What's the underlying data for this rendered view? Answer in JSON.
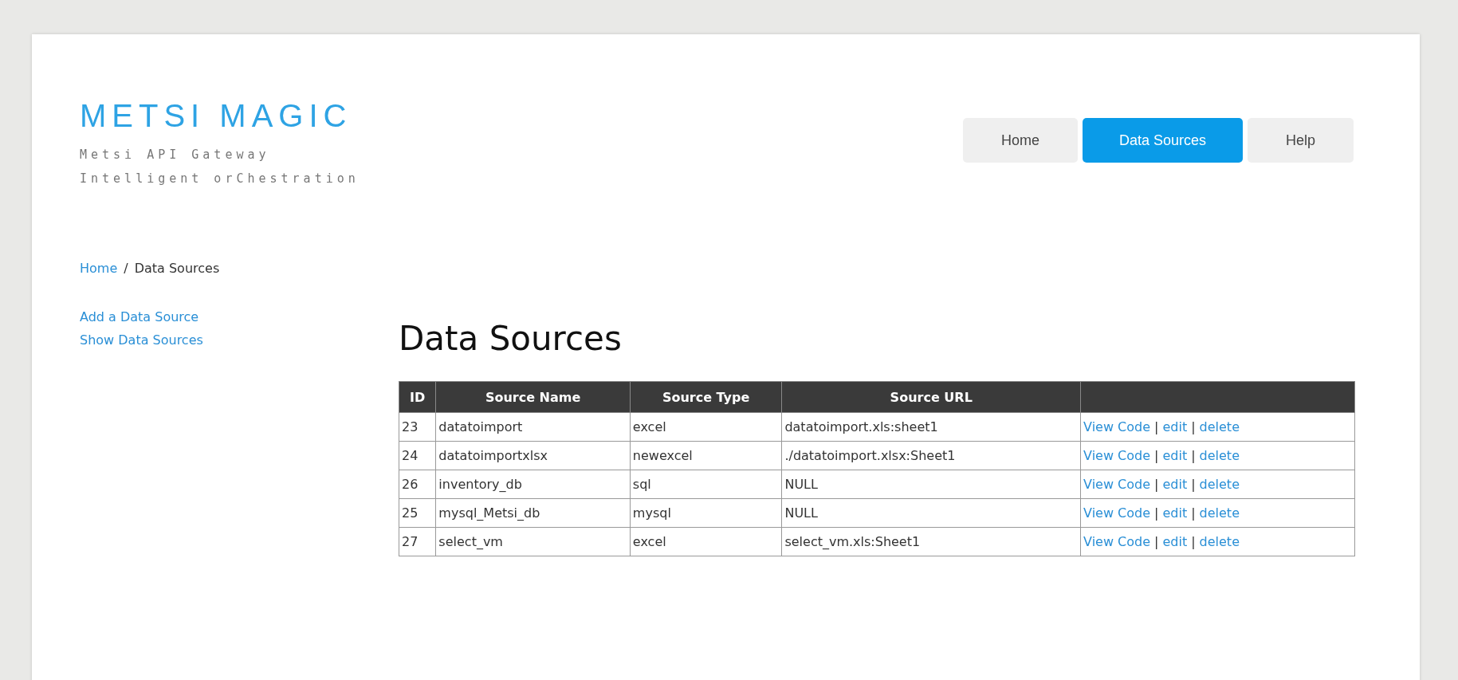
{
  "brand": {
    "title": "METSI MAGIC",
    "taglines": [
      "Metsi API Gateway",
      "Intelligent orChestration"
    ]
  },
  "nav": [
    {
      "label": "Home",
      "selected": false
    },
    {
      "label": "Data Sources",
      "selected": true
    },
    {
      "label": "Help",
      "selected": false
    }
  ],
  "breadcrumb": {
    "link": "Home",
    "separator": "/",
    "current": "Data Sources"
  },
  "sidebar": {
    "items": [
      "Add a Data Source",
      "Show Data Sources"
    ]
  },
  "heading": "Data Sources",
  "table": {
    "columns": [
      "ID",
      "Source Name",
      "Source Type",
      "Source URL"
    ],
    "action_separator": "|",
    "rows": [
      {
        "cells": [
          "23",
          "datatoimport",
          "excel",
          "datatoimport.xls:sheet1"
        ],
        "actions": [
          "View Code",
          "edit",
          "delete"
        ]
      },
      {
        "cells": [
          "24",
          "datatoimportxlsx",
          "newexcel",
          "./datatoimport.xlsx:Sheet1"
        ],
        "actions": [
          "View Code",
          "edit",
          "delete"
        ]
      },
      {
        "cells": [
          "26",
          "inventory_db",
          "sql",
          "NULL"
        ],
        "actions": [
          "View Code",
          "edit",
          "delete"
        ]
      },
      {
        "cells": [
          "25",
          "mysql_Metsi_db",
          "mysql",
          "NULL"
        ],
        "actions": [
          "View Code",
          "edit",
          "delete"
        ]
      },
      {
        "cells": [
          "27",
          "select_vm",
          "excel",
          "select_vm.xls:Sheet1"
        ],
        "actions": [
          "View Code",
          "edit",
          "delete"
        ]
      }
    ]
  }
}
